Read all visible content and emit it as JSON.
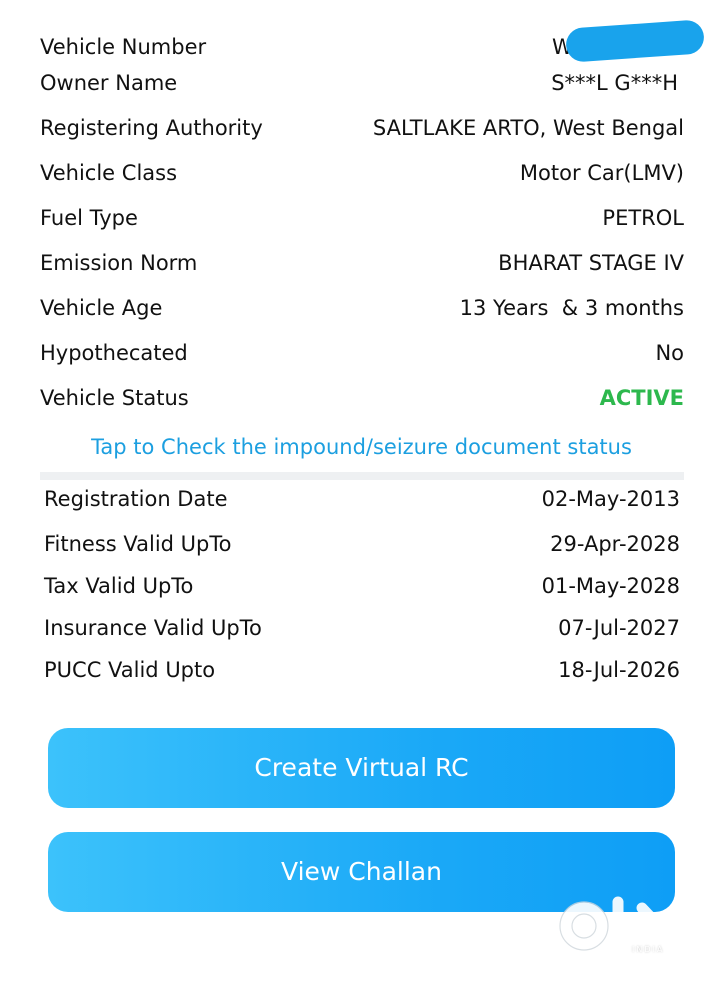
{
  "details": [
    {
      "label": "Vehicle Number",
      "value": "W"
    },
    {
      "label": "Owner Name",
      "value": "S***L G***H"
    },
    {
      "label": "Registering Authority",
      "value": "SALTLAKE ARTO, West Bengal"
    },
    {
      "label": "Vehicle Class",
      "value": "Motor Car(LMV)"
    },
    {
      "label": "Fuel Type",
      "value": "PETROL"
    },
    {
      "label": "Emission Norm",
      "value": "BHARAT STAGE IV"
    },
    {
      "label": "Vehicle Age",
      "value": "13 Years  & 3 months"
    },
    {
      "label": "Hypothecated",
      "value": "No"
    },
    {
      "label": "Vehicle Status",
      "value": "ACTIVE"
    }
  ],
  "status_color": "#2db84d",
  "impound_link": "Tap to Check the impound/seizure document status",
  "validity": [
    {
      "label": "Registration Date",
      "value": "02-May-2013"
    },
    {
      "label": "Fitness Valid UpTo",
      "value": "29-Apr-2028"
    },
    {
      "label": "Tax Valid UpTo",
      "value": "01-May-2028"
    },
    {
      "label": "Insurance Valid UpTo",
      "value": "07-Jul-2027"
    },
    {
      "label": "PUCC Valid Upto",
      "value": "18-Jul-2026"
    }
  ],
  "buttons": {
    "virtual_rc": "Create Virtual RC",
    "challan": "View Challan"
  },
  "watermark": {
    "logo": "olx",
    "sub": "INDIA"
  },
  "accent_color": "#1ba9f7"
}
